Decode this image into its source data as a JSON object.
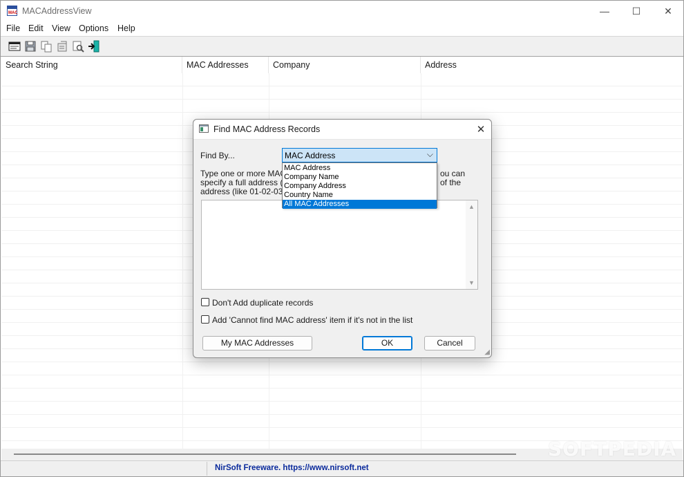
{
  "window": {
    "title": "MACAddressView",
    "minimize_glyph": "—",
    "maximize_glyph": "☐",
    "close_glyph": "✕"
  },
  "menu": [
    {
      "label": "File"
    },
    {
      "label": "Edit"
    },
    {
      "label": "View"
    },
    {
      "label": "Options"
    },
    {
      "label": "Help"
    }
  ],
  "toolbar": {
    "buttons": [
      {
        "icon": "find-icon"
      },
      {
        "icon": "save-icon"
      },
      {
        "icon": "copy-icon"
      },
      {
        "icon": "properties-icon"
      },
      {
        "icon": "search-icon"
      },
      {
        "icon": "exit-icon"
      }
    ]
  },
  "grid": {
    "columns": [
      {
        "label": "Search String"
      },
      {
        "label": "MAC Addresses"
      },
      {
        "label": "Company"
      },
      {
        "label": "Address"
      }
    ]
  },
  "status": {
    "text": "NirSoft Freeware. https://www.nirsoft.net"
  },
  "watermark": {
    "text": "SOFTPEDIA",
    "reg": "®"
  },
  "dialog": {
    "title": "Find MAC Address Records",
    "close_glyph": "✕",
    "find_by_label": "Find By...",
    "find_by_value": "MAC Address",
    "dropdown_options": [
      "MAC Address",
      "Company Name",
      "Company Address",
      "Country Name",
      "All MAC Addresses"
    ],
    "dropdown_selected": "All MAC Addresses",
    "instructions_visible": {
      "line1_left": "Type one or more MAC a",
      "line1_right": "ou can",
      "line2_left": "specify a full address (lik",
      "line2_right": "of the",
      "line3": "address (like 01-02-03)"
    },
    "textarea_value": "",
    "checkbox_no_duplicates": {
      "label": "Don't Add duplicate records",
      "checked": false
    },
    "checkbox_cannot_find": {
      "label": "Add 'Cannot find MAC address' item if it's not in the list",
      "checked": false
    },
    "buttons": {
      "my_mac": "My MAC Addresses",
      "ok": "OK",
      "cancel": "Cancel"
    }
  },
  "colors": {
    "accent": "#0078d7",
    "status_text": "#0a2a9c",
    "selection": "#0078d7"
  }
}
